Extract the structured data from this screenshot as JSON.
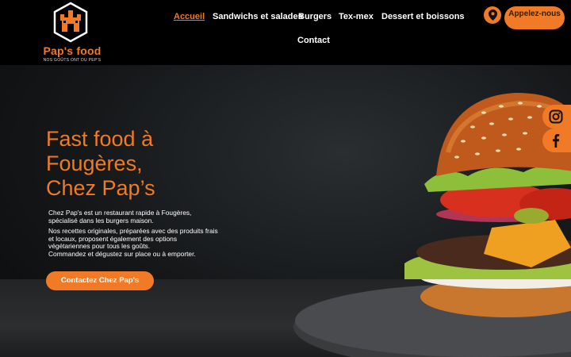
{
  "brand": {
    "name": "Pap's food",
    "tagline": "NOS GOÛTS ONT DU PEP'S",
    "accent": "#f07a26"
  },
  "nav": {
    "items": [
      {
        "label": "Accueil",
        "active": true
      },
      {
        "label": "Sandwichs et salades"
      },
      {
        "label": "Burgers"
      },
      {
        "label": "Tex-mex"
      },
      {
        "label": "Dessert et boissons"
      },
      {
        "label": "Contact"
      }
    ],
    "call_label": "Appelez-nous",
    "map_icon": "map-pin-icon"
  },
  "hero": {
    "title_lines": [
      "Fast food à",
      "Fougères,",
      "Chez Pap’s"
    ],
    "paragraphs": [
      "Chez Pap's est un restaurant rapide à Fougères, spécialisé dans les burgers maison.",
      "Nos recettes originales, préparées avec des produits frais et locaux, proposent également des options végétariennes pour tous les goûts.",
      "Commandez et dégustez sur place ou à emporter."
    ],
    "cta_label": "Contactez Chez Pap's"
  },
  "social": {
    "icons": [
      "instagram-icon",
      "facebook-icon"
    ]
  }
}
